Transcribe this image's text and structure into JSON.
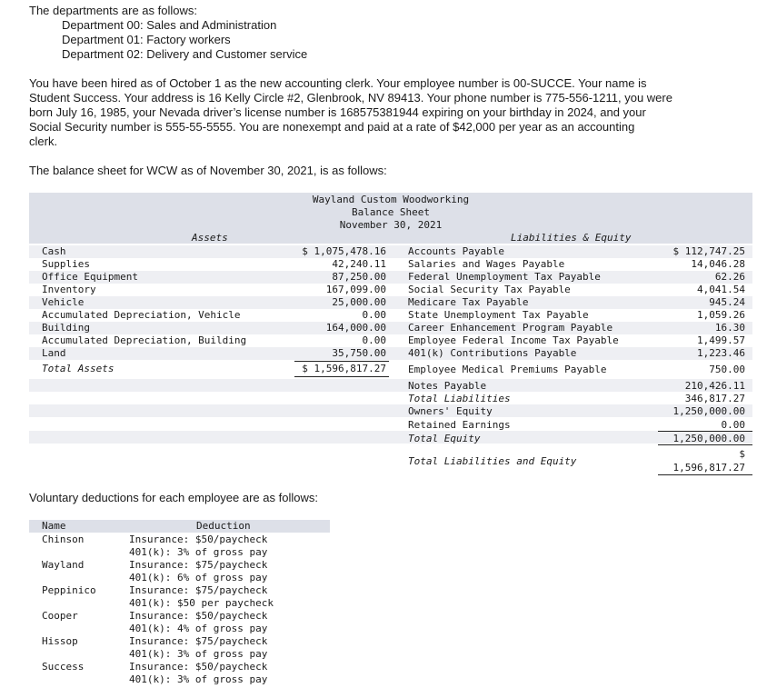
{
  "intro": {
    "heading": "The departments are as follows:",
    "departments": [
      "Department 00: Sales and Administration",
      "Department 01: Factory workers",
      "Department 02: Delivery and Customer service"
    ],
    "paragraph_lines": [
      "You have been hired as of October 1 as the new accounting clerk. Your employee number is 00-SUCCE. Your name is",
      "Student Success. Your address is 16 Kelly Circle #2, Glenbrook, NV 89413. Your phone number is 775-556-1211, you were",
      "born July 16, 1985, your Nevada driver’s license number is 168575381944 expiring on your birthday in 2024, and your",
      "Social Security number is 555-55-5555. You are nonexempt and paid at a rate of $42,000 per year as an accounting",
      "clerk."
    ],
    "balance_intro": "The balance sheet for WCW as of November 30, 2021, is as follows:"
  },
  "balance_sheet": {
    "company": "Wayland Custom Woodworking",
    "title": "Balance Sheet",
    "date": "November 30, 2021",
    "assets_header": "Assets",
    "liab_header": "Liabilities & Equity",
    "assets": [
      {
        "label": "Cash",
        "value": "$ 1,075,478.16"
      },
      {
        "label": "Supplies",
        "value": "42,240.11"
      },
      {
        "label": "Office Equipment",
        "value": "87,250.00"
      },
      {
        "label": "Inventory",
        "value": "167,099.00"
      },
      {
        "label": "Vehicle",
        "value": "25,000.00"
      },
      {
        "label": "Accumulated Depreciation, Vehicle",
        "value": "0.00"
      },
      {
        "label": "Building",
        "value": "164,000.00"
      },
      {
        "label": "Accumulated Depreciation, Building",
        "value": "0.00"
      },
      {
        "label": "Land",
        "value": "35,750.00"
      }
    ],
    "total_assets": {
      "label": "Total Assets",
      "value": "$ 1,596,817.27"
    },
    "liabilities": [
      {
        "label": "Accounts Payable",
        "value": "$ 112,747.25"
      },
      {
        "label": "Salaries and Wages Payable",
        "value": "14,046.28"
      },
      {
        "label": "Federal Unemployment Tax Payable",
        "value": "62.26"
      },
      {
        "label": "Social Security Tax Payable",
        "value": "4,041.54"
      },
      {
        "label": "Medicare Tax Payable",
        "value": "945.24"
      },
      {
        "label": "State Unemployment Tax Payable",
        "value": "1,059.26"
      },
      {
        "label": "Career Enhancement Program Payable",
        "value": "16.30"
      },
      {
        "label": "Employee Federal Income Tax Payable",
        "value": "1,499.57"
      },
      {
        "label": "401(k) Contributions Payable",
        "value": "1,223.46"
      },
      {
        "label": "Employee Medical Premiums Payable",
        "value": "750.00"
      },
      {
        "label": "Notes Payable",
        "value": "210,426.11"
      },
      {
        "label": "Total Liabilities",
        "value": "346,817.27"
      },
      {
        "label": "Owners' Equity",
        "value": "1,250,000.00"
      },
      {
        "label": "Retained Earnings",
        "value": "0.00"
      },
      {
        "label": "Total Equity",
        "value": "1,250,000.00"
      }
    ],
    "total_le": {
      "label": "Total Liabilities and Equity",
      "dollar": "$",
      "value": "1,596,817.27"
    }
  },
  "deductions": {
    "intro": "Voluntary deductions for each employee are as follows:",
    "col_name": "Name",
    "col_deduction": "Deduction",
    "rows": [
      {
        "name": "Chinson",
        "lines": [
          "Insurance: $50/paycheck",
          "401(k): 3% of gross pay"
        ]
      },
      {
        "name": "Wayland",
        "lines": [
          "Insurance: $75/paycheck",
          "401(k): 6% of gross pay"
        ]
      },
      {
        "name": "Peppinico",
        "lines": [
          "Insurance: $75/paycheck",
          "401(k): $50 per paycheck"
        ]
      },
      {
        "name": "Cooper",
        "lines": [
          "Insurance: $50/paycheck",
          "401(k): 4% of gross pay"
        ]
      },
      {
        "name": "Hissop",
        "lines": [
          "Insurance: $75/paycheck",
          "401(k): 3% of gross pay"
        ]
      },
      {
        "name": "Success",
        "lines": [
          "Insurance: $50/paycheck",
          "401(k): 3% of gross pay"
        ]
      }
    ]
  }
}
